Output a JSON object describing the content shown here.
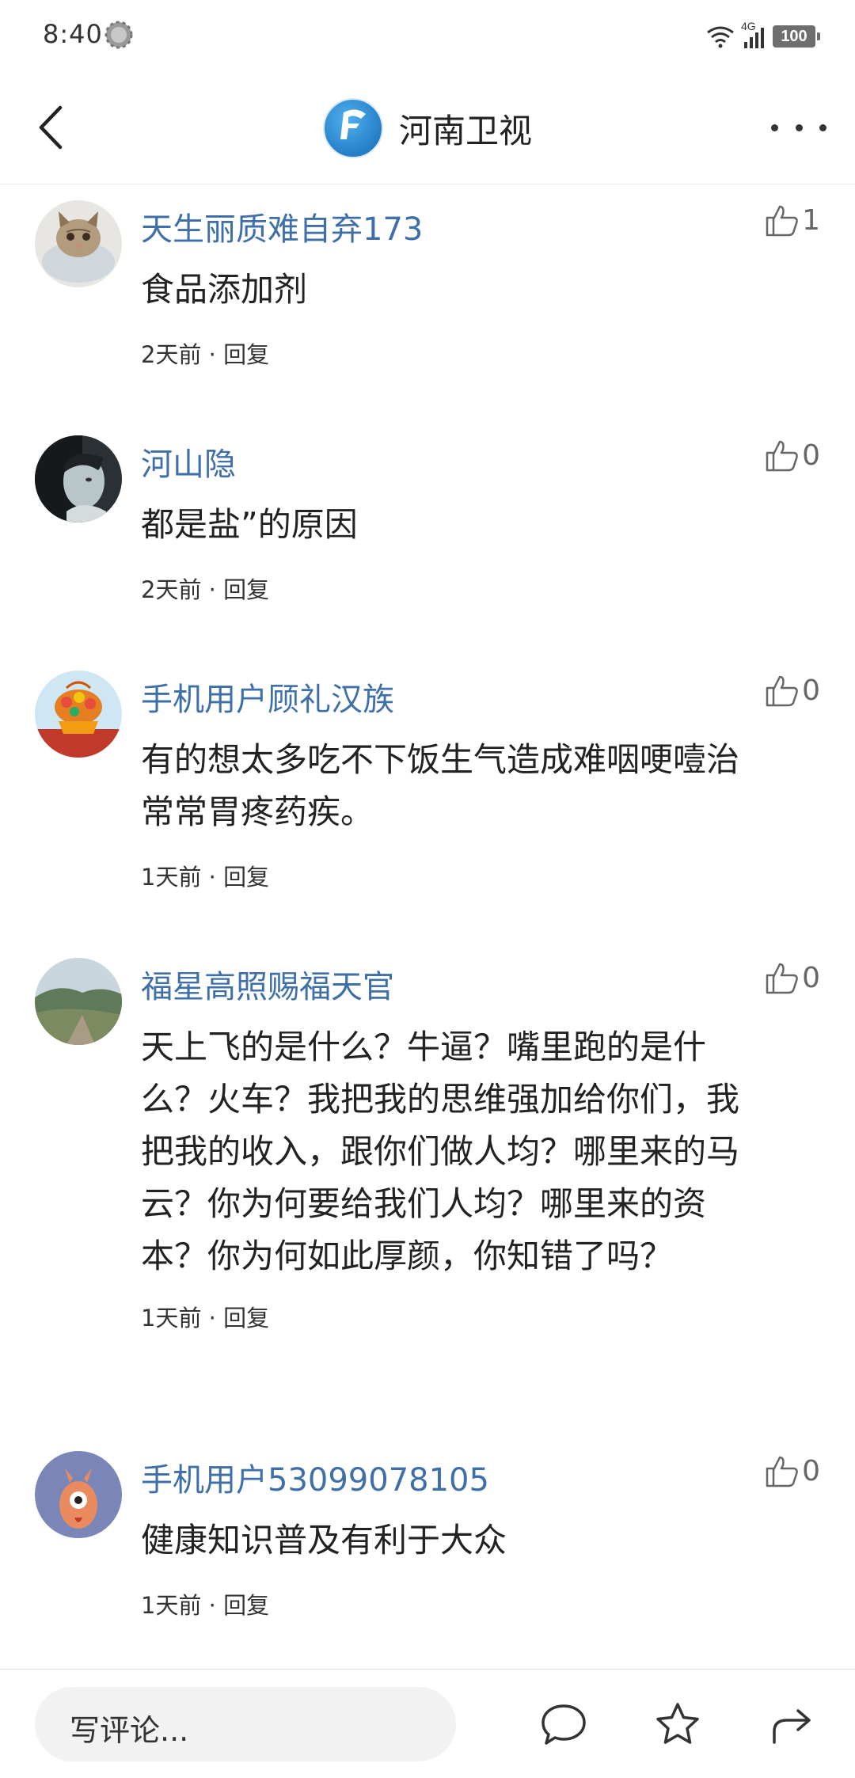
{
  "status_bar": {
    "time": "8:40",
    "network": "4G",
    "battery": "100"
  },
  "header": {
    "channel_name": "河南卫视",
    "logo_text": "河南卫视",
    "icons": {
      "back": "back-arrow-icon",
      "more": "more-icon"
    }
  },
  "comments": [
    {
      "username": "天生丽质难自弃173",
      "text": "食品添加剂",
      "time": "2天前",
      "separator": "·",
      "reply": "回复",
      "likes": "1",
      "avatar": "cat-avatar"
    },
    {
      "username": "河山隐",
      "text": "都是盐”的原因",
      "time": "2天前",
      "separator": "·",
      "reply": "回复",
      "likes": "0",
      "avatar": "portrait-avatar"
    },
    {
      "username": "手机用户顾礼汉族",
      "text": "有的想太多吃不下饭生气造成难咽哽噎治常常胃疼药疾。",
      "time": "1天前",
      "separator": "·",
      "reply": "回复",
      "likes": "0",
      "avatar": "flower-basket-avatar"
    },
    {
      "username": "福星高照赐福天官",
      "text": "天上飞的是什么？牛逼？嘴里跑的是什么？火车？我把我的思维强加给你们，我把我的收入，跟你们做人均？哪里来的马云？你为何要给我们人均？哪里来的资本？你为何如此厚颜，你知错了吗？",
      "time": "1天前",
      "separator": "·",
      "reply": "回复",
      "likes": "0",
      "avatar": "landscape-avatar"
    },
    {
      "username": "手机用户53099078105",
      "text": "健康知识普及有利于大众",
      "time": "1天前",
      "separator": "·",
      "reply": "回复",
      "likes": "0",
      "avatar": "cartoon-avatar"
    }
  ],
  "bottom_bar": {
    "input_placeholder": "写评论...",
    "icons": [
      "comment-icon",
      "star-icon",
      "share-icon"
    ]
  },
  "colors": {
    "username": "#3f6fa8",
    "text": "#222222",
    "meta": "#333333",
    "like": "#666666",
    "input_bg": "#f2f2f2"
  }
}
